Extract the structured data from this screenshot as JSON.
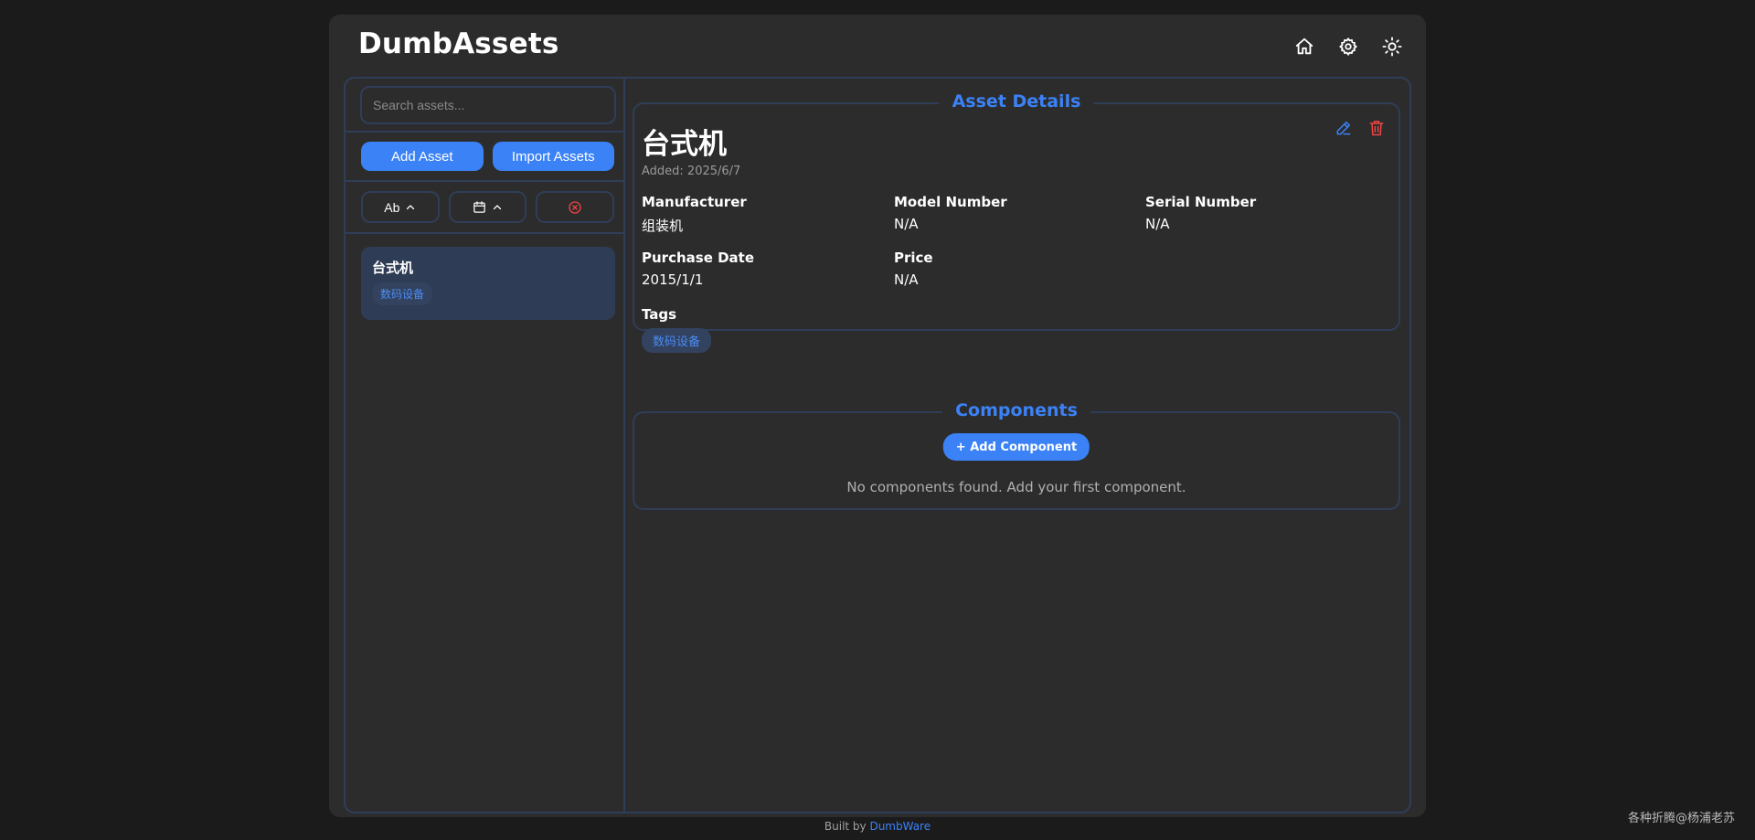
{
  "app": {
    "title": "DumbAssets"
  },
  "header": {
    "icons": [
      "home-icon",
      "settings-icon",
      "theme-toggle-icon"
    ]
  },
  "sidebar": {
    "search": {
      "placeholder": "Search assets...",
      "value": ""
    },
    "buttons": {
      "add_asset": "Add Asset",
      "import_assets": "Import Assets"
    },
    "sort": {
      "name_label": "Ab",
      "icons": [
        "chevron-up-icon",
        "calendar-icon",
        "clear-filter-icon"
      ]
    },
    "assets": [
      {
        "name": "台式机",
        "tags": [
          "数码设备"
        ],
        "selected": true
      }
    ]
  },
  "details": {
    "legend": "Asset Details",
    "title": "台式机",
    "added": "Added: 2025/6/7",
    "fields": {
      "manufacturer": {
        "label": "Manufacturer",
        "value": "组装机"
      },
      "model_number": {
        "label": "Model Number",
        "value": "N/A"
      },
      "serial_number": {
        "label": "Serial Number",
        "value": "N/A"
      },
      "purchase_date": {
        "label": "Purchase Date",
        "value": "2015/1/1"
      },
      "price": {
        "label": "Price",
        "value": "N/A"
      }
    },
    "tags": {
      "label": "Tags",
      "items": [
        "数码设备"
      ]
    },
    "actions": [
      "edit-icon",
      "delete-icon"
    ]
  },
  "components": {
    "legend": "Components",
    "add_button": "+ Add Component",
    "empty_text": "No components found. Add your first component."
  },
  "footer": {
    "prefix": "Built by ",
    "link_text": "DumbWare"
  },
  "watermark": "各种折腾@杨浦老苏",
  "colors": {
    "accent": "#3b82f6",
    "danger": "#ef4444",
    "border": "#2f3e58",
    "panel": "#2c2c2c",
    "background": "#1b1b1b"
  }
}
